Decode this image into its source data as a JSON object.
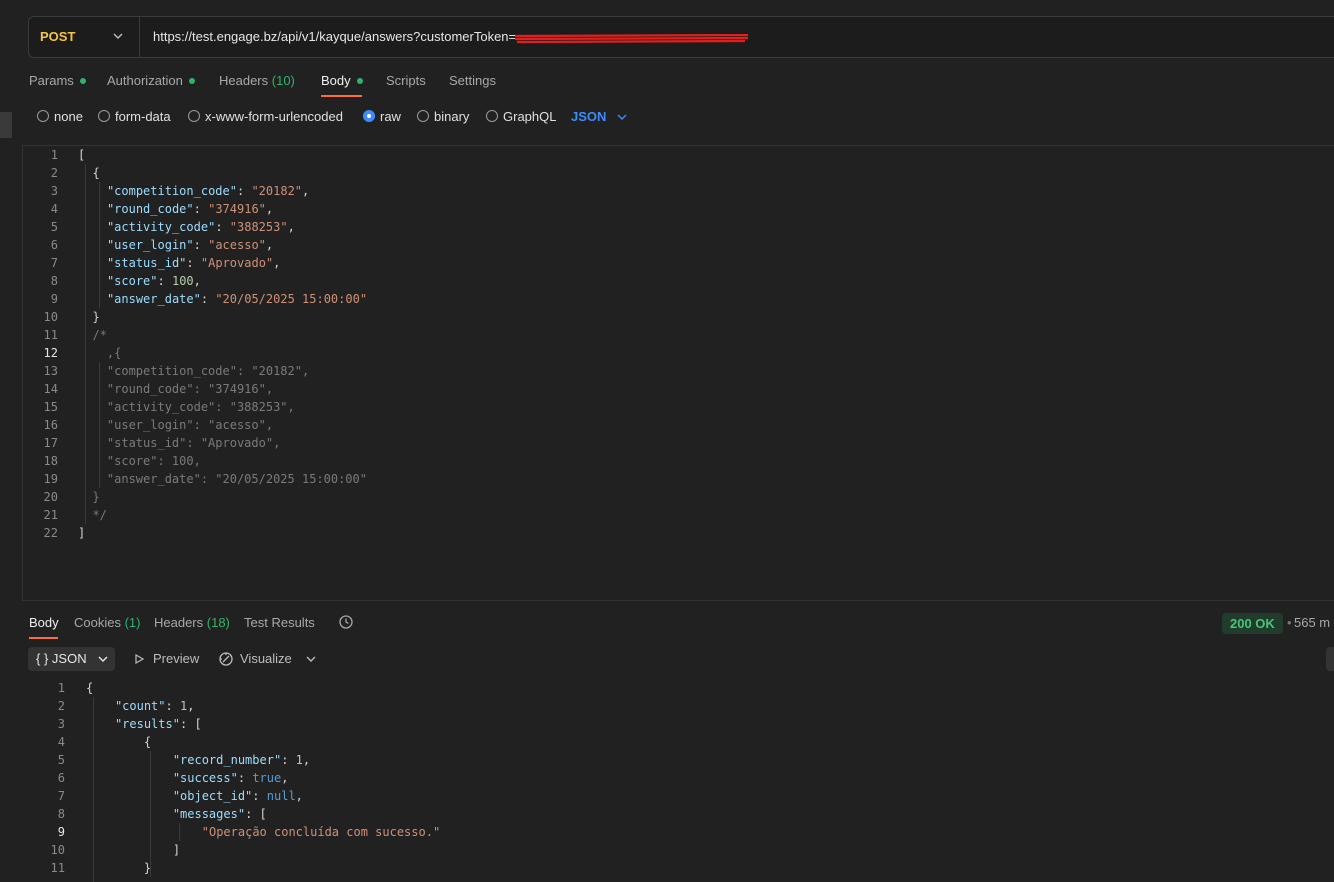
{
  "request": {
    "method": "POST",
    "url": "https://test.engage.bz/api/v1/kayque/answers?customerToken=",
    "tabs": [
      {
        "label": "Params",
        "dot": true
      },
      {
        "label": "Authorization",
        "dot": true
      },
      {
        "label": "Headers",
        "count": "(10)"
      },
      {
        "label": "Body",
        "dot": true,
        "active": true
      },
      {
        "label": "Scripts"
      },
      {
        "label": "Settings"
      }
    ],
    "body_types": [
      "none",
      "form-data",
      "x-www-form-urlencoded",
      "raw",
      "binary",
      "GraphQL"
    ],
    "selected_body_type": "raw",
    "format": "JSON"
  },
  "editor": {
    "lines": [
      "[",
      "  {",
      "    \"competition_code\": \"20182\",",
      "    \"round_code\": \"374916\",",
      "    \"activity_code\": \"388253\",",
      "    \"user_login\": \"acesso\",",
      "    \"status_id\": \"Aprovado\",",
      "    \"score\": 100,",
      "    \"answer_date\": \"20/05/2025 15:00:00\"",
      "  }",
      "  /*",
      "    ,{",
      "    \"competition_code\": \"20182\",",
      "    \"round_code\": \"374916\",",
      "    \"activity_code\": \"388253\",",
      "    \"user_login\": \"acesso\",",
      "    \"status_id\": \"Aprovado\",",
      "    \"score\": 100,",
      "    \"answer_date\": \"20/05/2025 15:00:00\"",
      "  }",
      "  */",
      "]"
    ],
    "current_line": 12
  },
  "response": {
    "tabs": [
      {
        "label": "Body",
        "active": true
      },
      {
        "label": "Cookies",
        "count": "(1)"
      },
      {
        "label": "Headers",
        "count": "(18)"
      },
      {
        "label": "Test Results"
      }
    ],
    "status": "200 OK",
    "time": "565 m",
    "format": "{ } JSON",
    "preview_label": "Preview",
    "visualize_label": "Visualize",
    "lines": [
      "{",
      "    \"count\": 1,",
      "    \"results\": [",
      "        {",
      "            \"record_number\": 1,",
      "            \"success\": true,",
      "            \"object_id\": null,",
      "            \"messages\": [",
      "                \"Operação concluída com sucesso.\"",
      "            ]",
      "        }"
    ],
    "current_line": 9
  }
}
